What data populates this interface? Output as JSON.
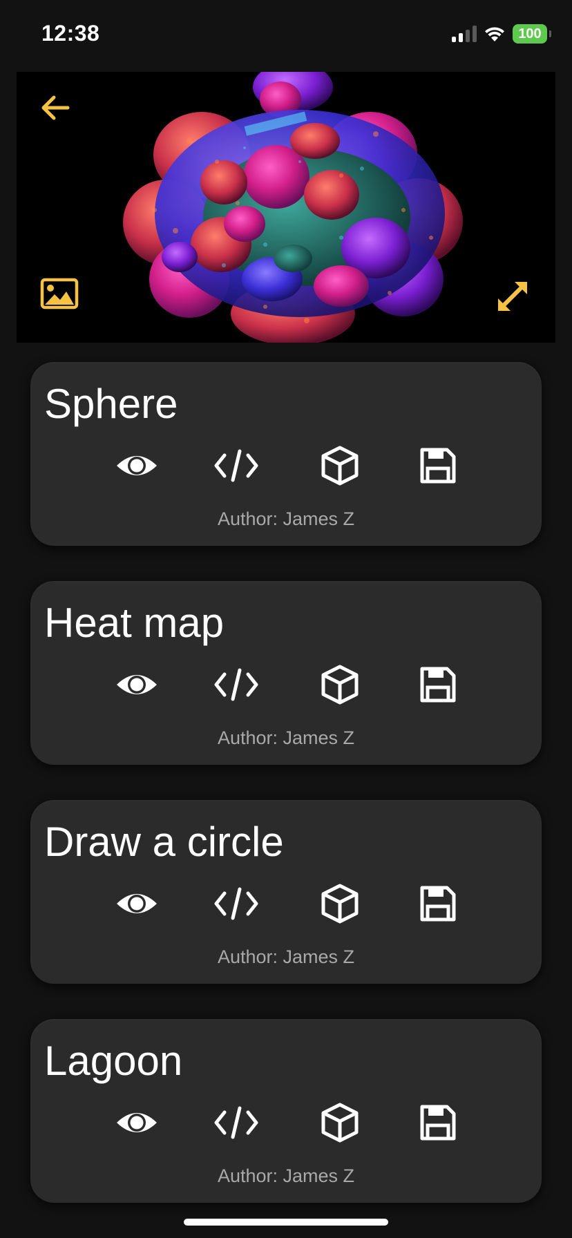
{
  "status_bar": {
    "time": "12:38",
    "battery": "100"
  },
  "hero": {
    "back_icon": "arrow-left-icon",
    "gallery_icon": "image-icon",
    "expand_icon": "expand-arrows-icon",
    "accent_color": "#f5c242"
  },
  "cards": [
    {
      "title": "Sphere",
      "author": "Author: James Z"
    },
    {
      "title": "Heat map",
      "author": "Author: James Z"
    },
    {
      "title": "Draw a circle",
      "author": "Author: James Z"
    },
    {
      "title": "Lagoon",
      "author": "Author: James Z"
    }
  ],
  "card_actions": [
    "eye-icon",
    "code-icon",
    "cube-icon",
    "floppy-disk-icon"
  ]
}
